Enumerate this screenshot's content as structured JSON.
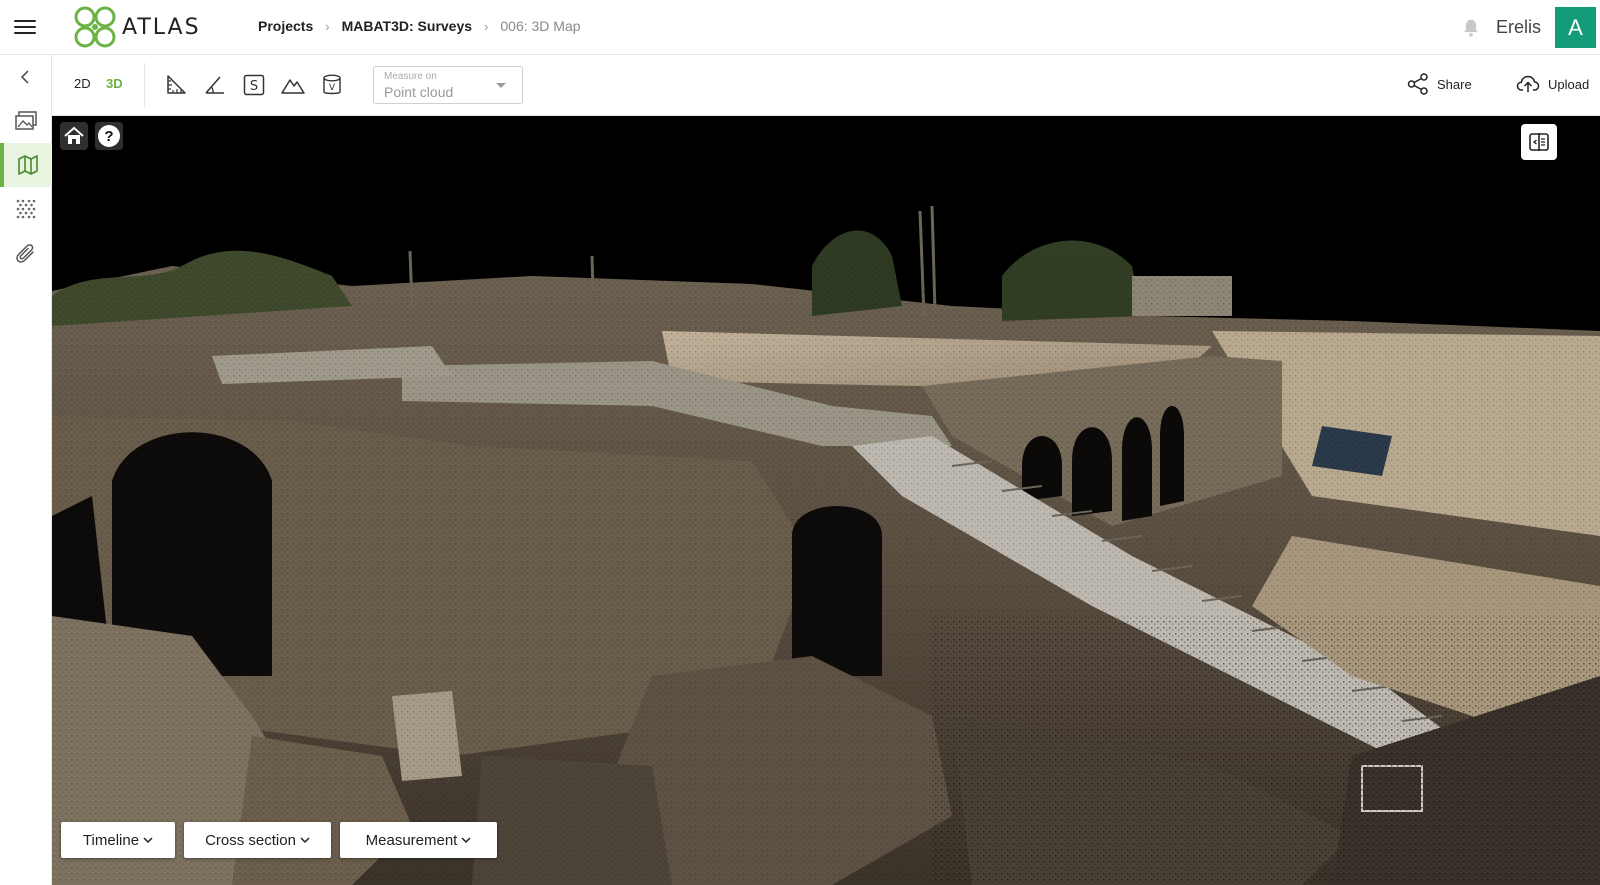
{
  "app": {
    "name": "ATLAS"
  },
  "breadcrumb": [
    {
      "label": "Projects"
    },
    {
      "label": "MABAT3D: Surveys"
    },
    {
      "label": "006: 3D Map"
    }
  ],
  "user": {
    "name": "Erelis",
    "avatar_letter": "A",
    "avatar_color": "#149c78"
  },
  "toolbar": {
    "mode_2d": "2D",
    "mode_3d": "3D",
    "active_mode": "3D",
    "tools": [
      "distance-ruler-icon",
      "angle-icon",
      "area-s-icon",
      "height-profile-icon",
      "volume-v-icon"
    ],
    "measure_select": {
      "label": "Measure on",
      "value": "Point cloud"
    },
    "share_label": "Share",
    "upload_label": "Upload"
  },
  "sidebar": {
    "items": [
      {
        "icon": "collapse-chevron-left-icon"
      },
      {
        "icon": "gallery-images-icon"
      },
      {
        "icon": "map-icon",
        "active": true
      },
      {
        "icon": "point-cloud-dots-icon"
      },
      {
        "icon": "paperclip-attachment-icon"
      }
    ]
  },
  "viewer": {
    "home_icon": "home-icon",
    "help_label": "?",
    "compare_icon": "split-compare-icon",
    "bottom_buttons": [
      {
        "label": "Timeline"
      },
      {
        "label": "Cross section"
      },
      {
        "label": "Measurement"
      }
    ]
  },
  "colors": {
    "accent": "#6ab344",
    "avatar": "#149c78",
    "viewer_bg": "#000000"
  }
}
